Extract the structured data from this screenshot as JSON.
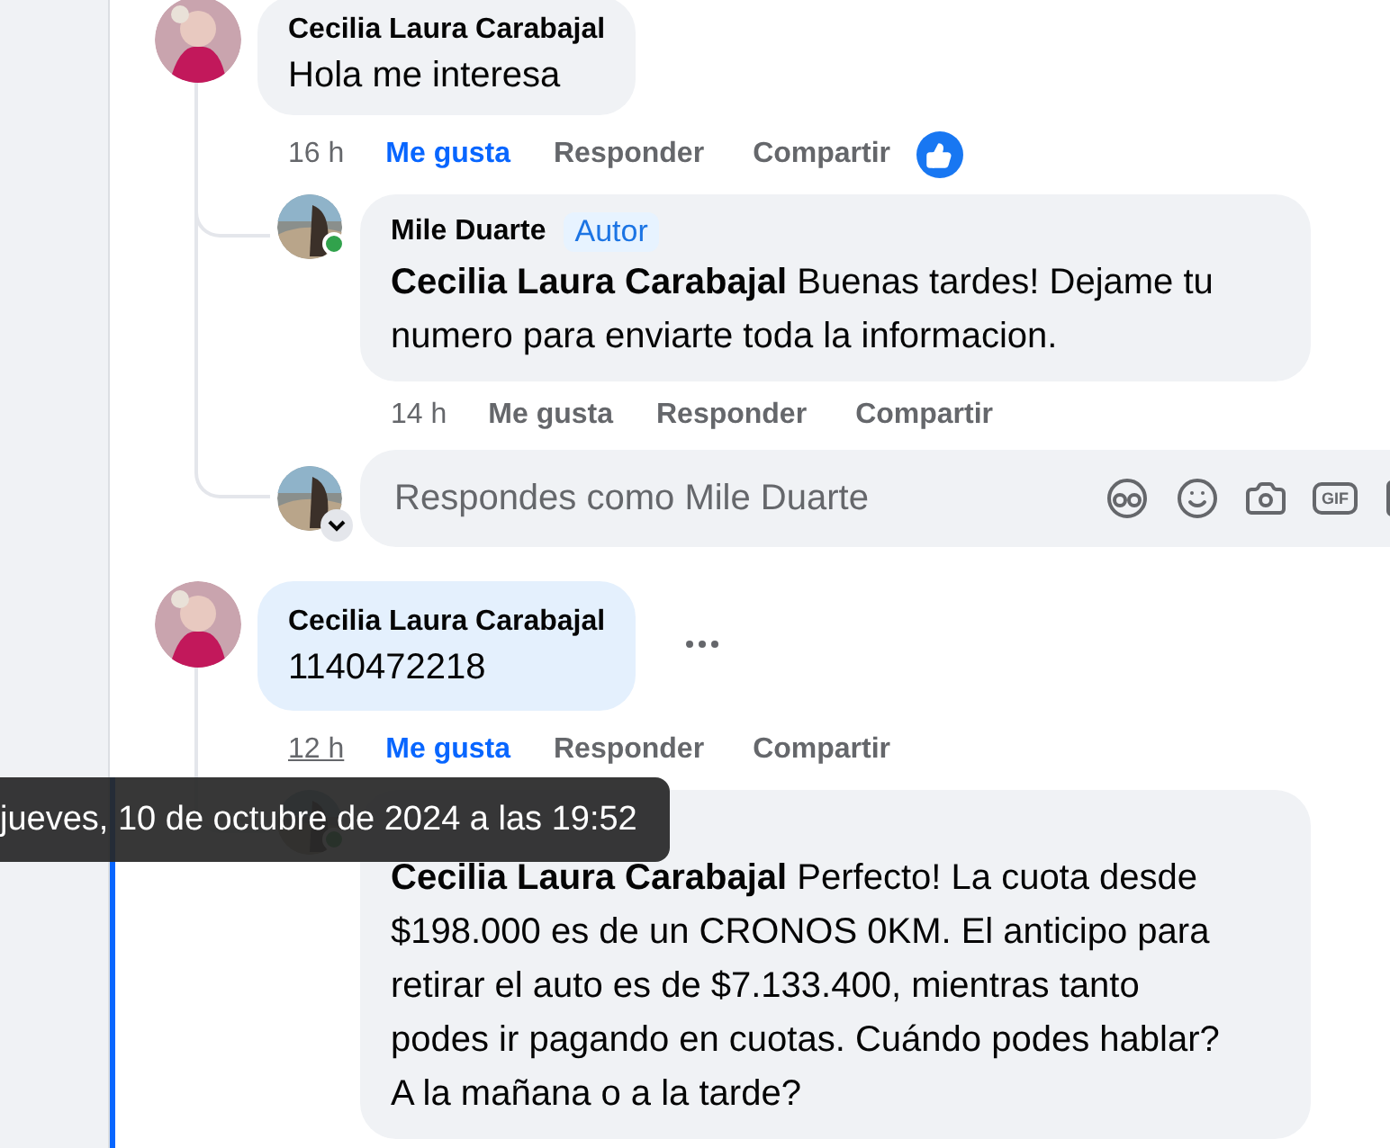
{
  "comments": [
    {
      "author": "Cecilia Laura Carabajal",
      "text": "Hola me interesa",
      "highlighted": false,
      "more_button": false,
      "time": "16 h",
      "time_underlined": false,
      "like": "Me gusta",
      "liked": true,
      "reply": "Responder",
      "share": "Compartir",
      "reaction": true,
      "replies": [
        {
          "kind": "reply",
          "author": "Mile Duarte",
          "badge": "Autor",
          "online": true,
          "text": "**Cecilia Laura Carabajal** Buenas tardes! Dejame tu numero para enviarte toda la informacion.",
          "time": "14 h",
          "time_underlined": false,
          "like": "Me gusta",
          "liked": false,
          "reply": "Responder",
          "share": "Compartir"
        },
        {
          "kind": "composer",
          "placeholder": "Respondes como Mile Duarte",
          "gif_label": "GIF"
        }
      ]
    },
    {
      "author": "Cecilia Laura Carabajal",
      "text": "1140472218",
      "highlighted": true,
      "more_button": true,
      "time": "12 h",
      "time_underlined": true,
      "like": "Me gusta",
      "liked": true,
      "reply": "Responder",
      "share": "Compartir",
      "reaction": false,
      "replies": [
        {
          "kind": "reply",
          "online": true,
          "text": "**Cecilia Laura Carabajal** Perfecto! La cuota desde $198.000 es de un CRONOS 0KM. El anticipo para retirar el auto es de $7.133.400, mientras tanto podes ir pagando en cuotas. Cuándo podes hablar? A la mañana o a la tarde?"
        }
      ]
    }
  ],
  "tooltip": "jueves, 10 de octubre de 2024 a las 19:52"
}
